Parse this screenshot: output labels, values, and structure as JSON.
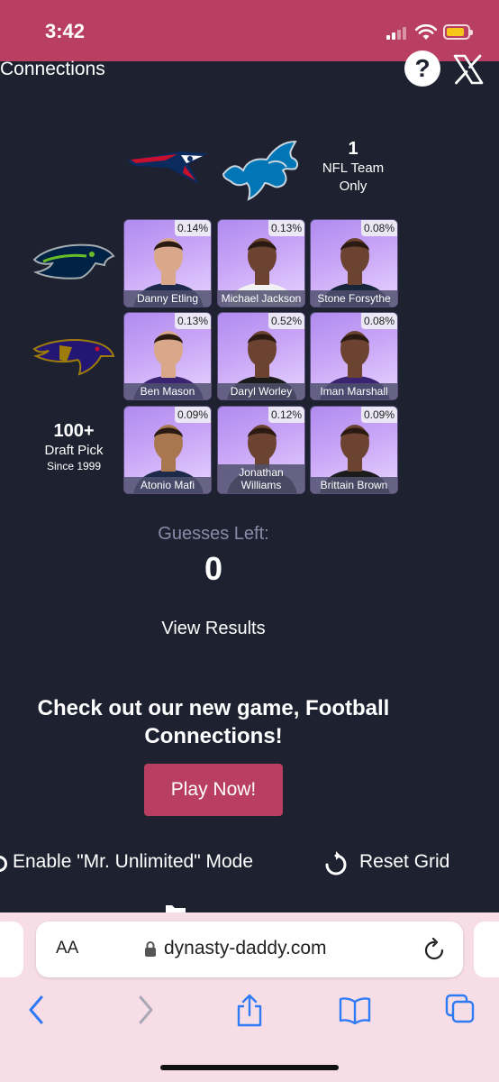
{
  "status": {
    "time": "3:42"
  },
  "header": {
    "title": "Connections",
    "help_label": "?"
  },
  "columns": [
    {
      "name": "New England Patriots"
    },
    {
      "name": "Detroit Lions"
    },
    {
      "big": "1",
      "line1": "NFL Team",
      "line2": "Only"
    }
  ],
  "rows": [
    {
      "name": "Seattle Seahawks"
    },
    {
      "name": "Baltimore Ravens"
    },
    {
      "big": "100+",
      "line1": "Draft Pick",
      "line2": "Since 1999"
    }
  ],
  "grid": [
    [
      {
        "pct": "0.14%",
        "name": "Danny Etling",
        "jersey": "#1d2a4a"
      },
      {
        "pct": "0.13%",
        "name": "Michael Jackson",
        "jersey": "#f2f2f2"
      },
      {
        "pct": "0.08%",
        "name": "Stone Forsythe",
        "jersey": "#18263a"
      }
    ],
    [
      {
        "pct": "0.13%",
        "name": "Ben Mason",
        "jersey": "#3a2471"
      },
      {
        "pct": "0.52%",
        "name": "Daryl Worley",
        "jersey": "#1b1b1b"
      },
      {
        "pct": "0.08%",
        "name": "Iman Marshall",
        "jersey": "#3a2471"
      }
    ],
    [
      {
        "pct": "0.09%",
        "name": "Atonio Mafi",
        "jersey": "#1d2a4a"
      },
      {
        "pct": "0.12%",
        "name": "Jonathan Williams",
        "jersey": "#1b1b1b"
      },
      {
        "pct": "0.09%",
        "name": "Brittain Brown",
        "jersey": "#1b1b1b"
      }
    ]
  ],
  "guesses": {
    "label": "Guesses Left:",
    "value": "0"
  },
  "view_results": "View Results",
  "promo": {
    "text": "Check out our new game, Football Connections!",
    "button": "Play Now!"
  },
  "options": {
    "unlimited": "Enable \"Mr. Unlimited\" Mode",
    "reset": "Reset Grid"
  },
  "browser": {
    "aa": "AA",
    "domain": "dynasty-daddy.com"
  },
  "colors": {
    "accent": "#b83e62",
    "background": "#1e2130",
    "chrome": "#f6dde6",
    "toolbar_icon": "#2f7bf5"
  }
}
